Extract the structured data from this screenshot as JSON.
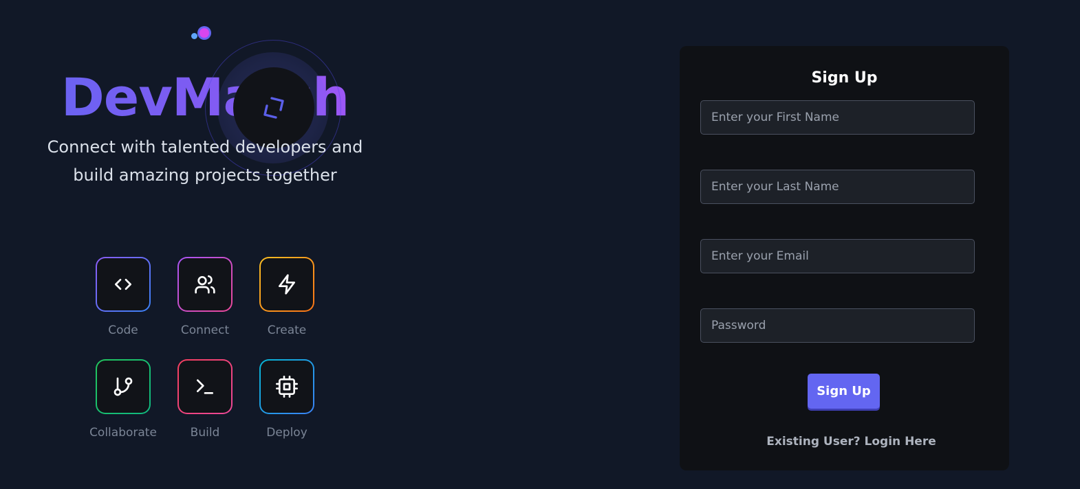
{
  "brand": {
    "title": "DevMatch",
    "tagline": "Connect with talented developers and build amazing projects together"
  },
  "badge": {
    "icon": "rotate-square-icon",
    "accent": "#6366f1"
  },
  "features": [
    {
      "label": "Code",
      "icon": "code-icon",
      "gradient": [
        "#8b5cf6",
        "#3b82f6"
      ]
    },
    {
      "label": "Connect",
      "icon": "users-icon",
      "gradient": [
        "#a855f7",
        "#ec4899"
      ]
    },
    {
      "label": "Create",
      "icon": "zap-icon",
      "gradient": [
        "#f59e0b",
        "#f97316"
      ]
    },
    {
      "label": "Collaborate",
      "icon": "git-branch-icon",
      "gradient": [
        "#22c55e",
        "#10b981"
      ]
    },
    {
      "label": "Build",
      "icon": "terminal-icon",
      "gradient": [
        "#f43f5e",
        "#ec4899"
      ]
    },
    {
      "label": "Deploy",
      "icon": "cpu-icon",
      "gradient": [
        "#06b6d4",
        "#3b82f6"
      ]
    }
  ],
  "signup": {
    "title": "Sign Up",
    "first_name": {
      "value": "",
      "placeholder": "Enter your First Name"
    },
    "last_name": {
      "value": "",
      "placeholder": "Enter your Last Name"
    },
    "email": {
      "value": "",
      "placeholder": "Enter your Email"
    },
    "password": {
      "value": "",
      "placeholder": "Password"
    },
    "submit_label": "Sign Up",
    "login_link": "Existing User? Login Here"
  },
  "colors": {
    "background": "#111827",
    "card": "#0f1115",
    "accent": "#6366f1",
    "brand_gradient": [
      "#6366f1",
      "#a855f7"
    ]
  }
}
